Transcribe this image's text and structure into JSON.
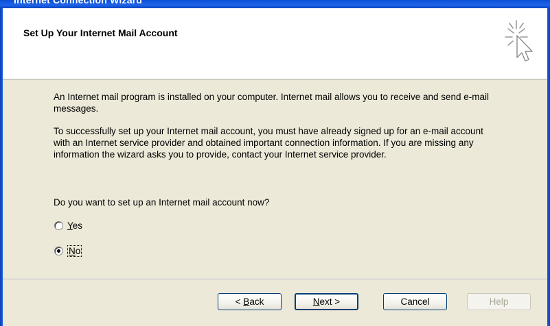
{
  "window": {
    "title": "Internet Connection Wizard"
  },
  "header": {
    "title": "Set Up Your Internet Mail Account",
    "icon": "cursor-sparkle-icon"
  },
  "content": {
    "paragraph1": "An Internet mail program is installed on your computer. Internet mail allows you to receive and send e-mail messages.",
    "paragraph2": "To successfully set up your Internet mail account, you must have already signed up for an e-mail account with an Internet service provider and obtained important connection information. If you are missing any information the wizard asks you to provide, contact your Internet service provider.",
    "question": "Do you want to set up an Internet mail account now?",
    "options": [
      {
        "label": "Yes",
        "mnemonic": "Y",
        "rest": "es",
        "selected": false
      },
      {
        "label": "No",
        "mnemonic": "N",
        "rest": "o",
        "selected": true
      }
    ]
  },
  "buttons": {
    "back_prefix": "< ",
    "back_mnemonic": "B",
    "back_rest": "ack",
    "next_mnemonic": "N",
    "next_rest": "ext >",
    "cancel": "Cancel",
    "help": "Help"
  },
  "colors": {
    "titlebar": "#0a4fd6",
    "dialog_background": "#ece9d8",
    "header_background": "#ffffff",
    "button_border": "#003c74",
    "disabled_text": "#aca899"
  }
}
